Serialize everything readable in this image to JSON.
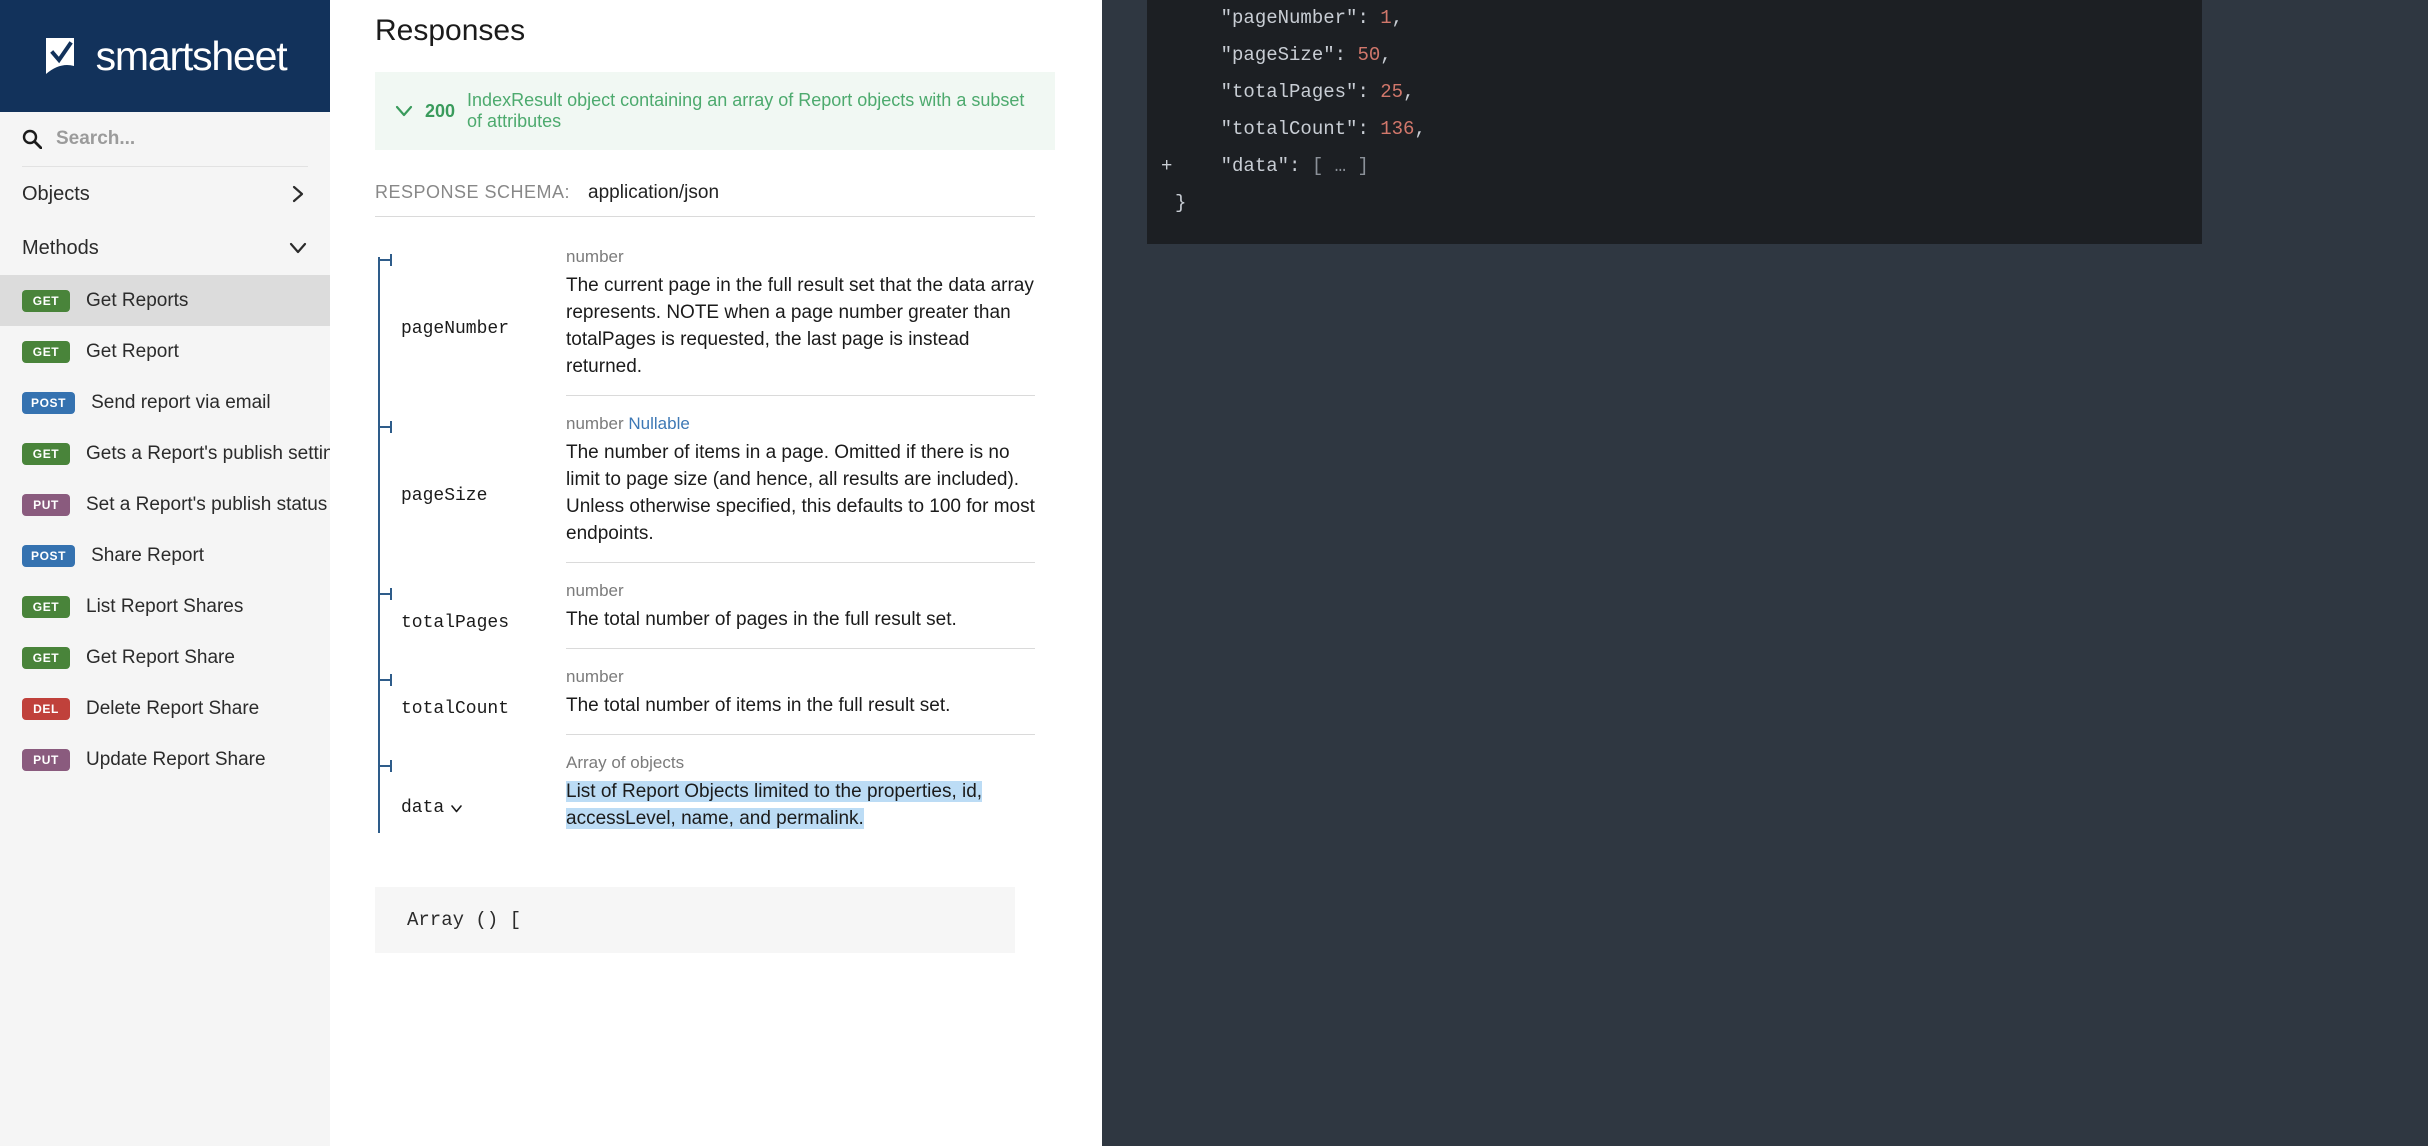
{
  "sidebar": {
    "brand": {
      "name": "smartsheet",
      "logo_icon": "smartsheet-check-logo"
    },
    "search": {
      "placeholder": "Search...",
      "icon": "search-icon"
    },
    "nav_groups": [
      {
        "label": "Objects",
        "icon": "chevron-right-icon",
        "expanded": false
      },
      {
        "label": "Methods",
        "icon": "chevron-down-icon",
        "expanded": true
      }
    ],
    "methods": [
      {
        "verb": "GET",
        "label": "Get Reports",
        "active": true
      },
      {
        "verb": "GET",
        "label": "Get Report",
        "active": false
      },
      {
        "verb": "POST",
        "label": "Send report via email",
        "active": false
      },
      {
        "verb": "GET",
        "label": "Gets a Report's publish settings",
        "active": false
      },
      {
        "verb": "PUT",
        "label": "Set a Report's publish status",
        "active": false
      },
      {
        "verb": "POST",
        "label": "Share Report",
        "active": false
      },
      {
        "verb": "GET",
        "label": "List Report Shares",
        "active": false
      },
      {
        "verb": "GET",
        "label": "Get Report Share",
        "active": false
      },
      {
        "verb": "DEL",
        "label": "Delete Report Share",
        "active": false
      },
      {
        "verb": "PUT",
        "label": "Update Report Share",
        "active": false
      }
    ]
  },
  "main": {
    "title": "Responses",
    "banner": {
      "chevron_icon": "chevron-down-icon",
      "status_code": "200",
      "description": "IndexResult object containing an array of Report objects with a subset of attributes"
    },
    "schema": {
      "label": "RESPONSE SCHEMA:",
      "value": "application/json"
    },
    "properties": [
      {
        "name": "pageNumber",
        "type": "number",
        "nullable": "",
        "description": "The current page in the full result set that the data array represents. NOTE when a page number greater than totalPages is requested, the last page is instead returned."
      },
      {
        "name": "pageSize",
        "type": "number",
        "nullable": "Nullable",
        "description": "The number of items in a page. Omitted if there is no limit to page size (and hence, all results are included). Unless otherwise specified, this defaults to 100 for most endpoints."
      },
      {
        "name": "totalPages",
        "type": "number",
        "nullable": "",
        "description": "The total number of pages in the full result set."
      },
      {
        "name": "totalCount",
        "type": "number",
        "nullable": "",
        "description": "The total number of items in the full result set."
      },
      {
        "name": "data",
        "expand_icon": "chevron-down-icon",
        "type": "Array of objects",
        "nullable": "",
        "description": "List of Report Objects limited to the properties, id, accessLevel, name, and permalink.",
        "highlighted": true
      }
    ],
    "array_sample": "Array () ["
  },
  "code_panel": {
    "lines": [
      {
        "indent": 1,
        "key": "\"pageNumber\"",
        "sep": ": ",
        "value": "1",
        "value_type": "num",
        "trail": ","
      },
      {
        "indent": 1,
        "key": "\"pageSize\"",
        "sep": ": ",
        "value": "50",
        "value_type": "num",
        "trail": ","
      },
      {
        "indent": 1,
        "key": "\"totalPages\"",
        "sep": ": ",
        "value": "25",
        "value_type": "num",
        "trail": ","
      },
      {
        "indent": 1,
        "key": "\"totalCount\"",
        "sep": ": ",
        "value": "136",
        "value_type": "num",
        "trail": ","
      },
      {
        "indent": 1,
        "key": "\"data\"",
        "sep": ": ",
        "value": "[ … ]",
        "value_type": "dim",
        "trail": "",
        "expander": "+"
      },
      {
        "indent": 0,
        "key": "}",
        "sep": "",
        "value": "",
        "value_type": "punct",
        "trail": ""
      }
    ]
  },
  "colors": {
    "brand_navy": "#12325b",
    "get_green": "#49843a",
    "post_blue": "#3572b0",
    "put_purple": "#8a5b7e",
    "del_red": "#c0413b",
    "banner_green": "#4daa6e",
    "selection_blue": "#bcdcf5",
    "code_bg": "#1c1f23"
  }
}
